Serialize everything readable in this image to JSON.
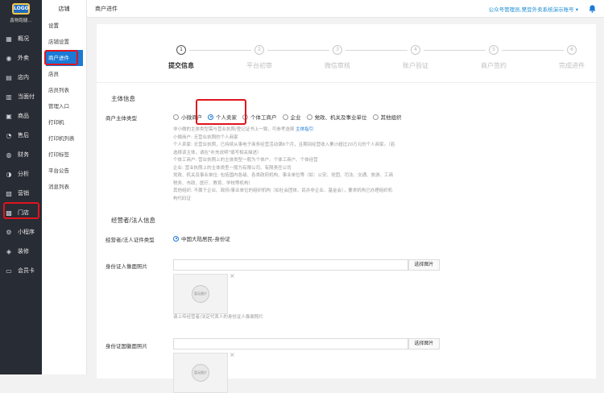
{
  "brand": {
    "logo_text": "LOGO",
    "name": "鑫物跑腿..."
  },
  "leftnav": [
    {
      "label": "概况",
      "icon": "grid-icon",
      "glyph": "▦"
    },
    {
      "label": "外卖",
      "icon": "takeout-icon",
      "glyph": "◉"
    },
    {
      "label": "店内",
      "icon": "store-icon",
      "glyph": "▤"
    },
    {
      "label": "当面付",
      "icon": "pay-icon",
      "glyph": "▥"
    },
    {
      "label": "商品",
      "icon": "goods-icon",
      "glyph": "▣"
    },
    {
      "label": "售后",
      "icon": "aftersale-icon",
      "glyph": "◔"
    },
    {
      "label": "财务",
      "icon": "finance-icon",
      "glyph": "◍"
    },
    {
      "label": "分析",
      "icon": "analysis-icon",
      "glyph": "◑"
    },
    {
      "label": "营销",
      "icon": "marketing-icon",
      "glyph": "▧"
    },
    {
      "label": "门店",
      "icon": "shop-icon",
      "glyph": "▩"
    },
    {
      "label": "小程序",
      "icon": "miniapp-icon",
      "glyph": "⚙"
    },
    {
      "label": "装修",
      "icon": "decorate-icon",
      "glyph": "◈"
    },
    {
      "label": "会员卡",
      "icon": "card-icon",
      "glyph": "▭"
    }
  ],
  "subnav": {
    "title": "店铺",
    "items": [
      {
        "label": "设置",
        "group": true
      },
      {
        "label": "店铺设置"
      },
      {
        "label": "商户进件",
        "active": true
      },
      {
        "label": "店员",
        "group": true
      },
      {
        "label": "店员列表"
      },
      {
        "label": "管理入口"
      },
      {
        "label": "打印机",
        "group": true
      },
      {
        "label": "打印机列表"
      },
      {
        "label": "打印标签"
      },
      {
        "label": "平台公告",
        "group": true
      },
      {
        "label": "消息列表"
      }
    ]
  },
  "topbar": {
    "breadcrumb": "商户进件",
    "account": "公众号管理员,樊豆外卖系统演示账号 ▾"
  },
  "steps": [
    {
      "num": "1",
      "label": "提交信息"
    },
    {
      "num": "2",
      "label": "平台初审"
    },
    {
      "num": "3",
      "label": "微信审核"
    },
    {
      "num": "4",
      "label": "账户验证"
    },
    {
      "num": "5",
      "label": "商户签约"
    },
    {
      "num": "6",
      "label": "完成进件"
    }
  ],
  "subject": {
    "section_title": "主体信息",
    "type_label": "商户主体类型",
    "options": [
      "小微商户",
      "个人卖家",
      "个体工商户",
      "企业",
      "党政、机关及事业单位",
      "其他组织"
    ],
    "desc_lines": [
      "非小微的主体类型需与营业执照/登记证书上一致，可参考选择",
      "小微商户: 无营业执照的个人商家",
      "个人卖家: 无营业执照，已持续从事电子商务经营活动满6个月，且期间经营收入累计超过20万元的个人商家。（若",
      "选择该主体，请在\"补充说明\"填写相关描述）",
      "个体工商户: 营业执照上的主体类型一般为个体户、个体工商户、个体经营",
      "企业: 营业执照上的主体类型一般为有限公司、有限责任公司",
      "党政、机关及事业单位: 包括国内各级、各类政府机构、事业单位等（如：公安、党团、司法、交通、旅游、工商",
      "税务、市政、医疗、教育、学校等机构）",
      "其他组织: 不属于企业、政府/事业单位的组织机构（如社会团体、民办非企业、基金会），要求机构已办理组织机",
      "构代码证"
    ],
    "desc_link": "主体指引"
  },
  "operator": {
    "section_title": "经营者/法人信息",
    "id_type_label": "经营者/法人证件类型",
    "id_type_value": "中国大陆居民-身份证",
    "front_label": "身份证人像面照片",
    "back_label": "身份证国徽面照片",
    "select_btn": "选择图片",
    "placeholder_text": "暂无图片",
    "close_glyph": "×",
    "front_note": "请上传经营者/法定代表人的身份证人像面照片"
  },
  "colors": {
    "accent": "#1a7ad6",
    "nav_bg": "#282c34",
    "highlight": "#e0141e"
  }
}
